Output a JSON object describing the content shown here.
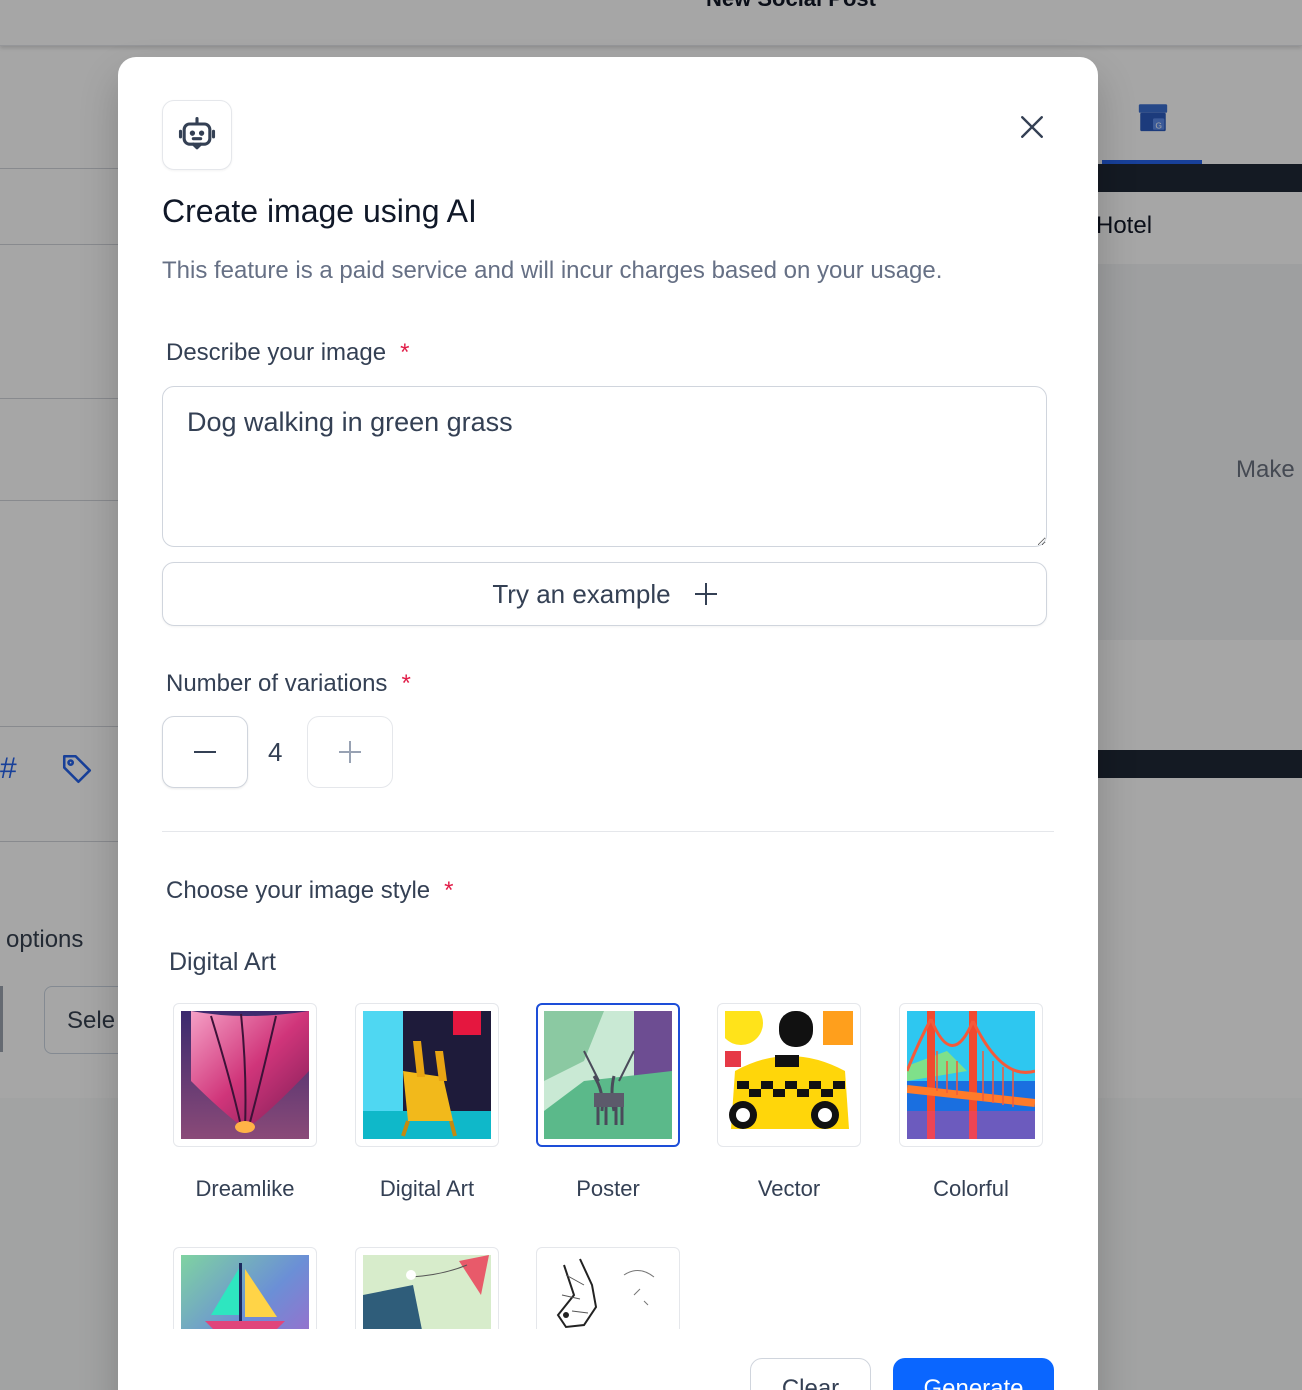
{
  "background": {
    "page_title": "New Social Post",
    "right_panel_text": "Hotel",
    "right_panel_hint": "Make",
    "left_options_label": "options",
    "left_select_value": "Sele"
  },
  "modal": {
    "icon": "robot-icon",
    "title": "Create image using AI",
    "subtitle": "This feature is a paid service and will incur charges based on your usage.",
    "describe": {
      "label": "Describe your image",
      "required_mark": "*",
      "value": "Dog walking in green grass"
    },
    "try_example_label": "Try an example",
    "variations": {
      "label": "Number of variations",
      "required_mark": "*",
      "value": "4"
    },
    "style": {
      "label": "Choose your image style",
      "required_mark": "*",
      "group_label": "Digital Art",
      "selected": "Poster",
      "options": [
        {
          "name": "Dreamlike"
        },
        {
          "name": "Digital Art"
        },
        {
          "name": "Poster"
        },
        {
          "name": "Vector"
        },
        {
          "name": "Colorful"
        }
      ]
    },
    "footer": {
      "clear_label": "Clear",
      "generate_label": "Generate"
    }
  },
  "colors": {
    "primary": "#0a66ff",
    "selected_border": "#1d4ed8",
    "required": "#e11d48"
  }
}
